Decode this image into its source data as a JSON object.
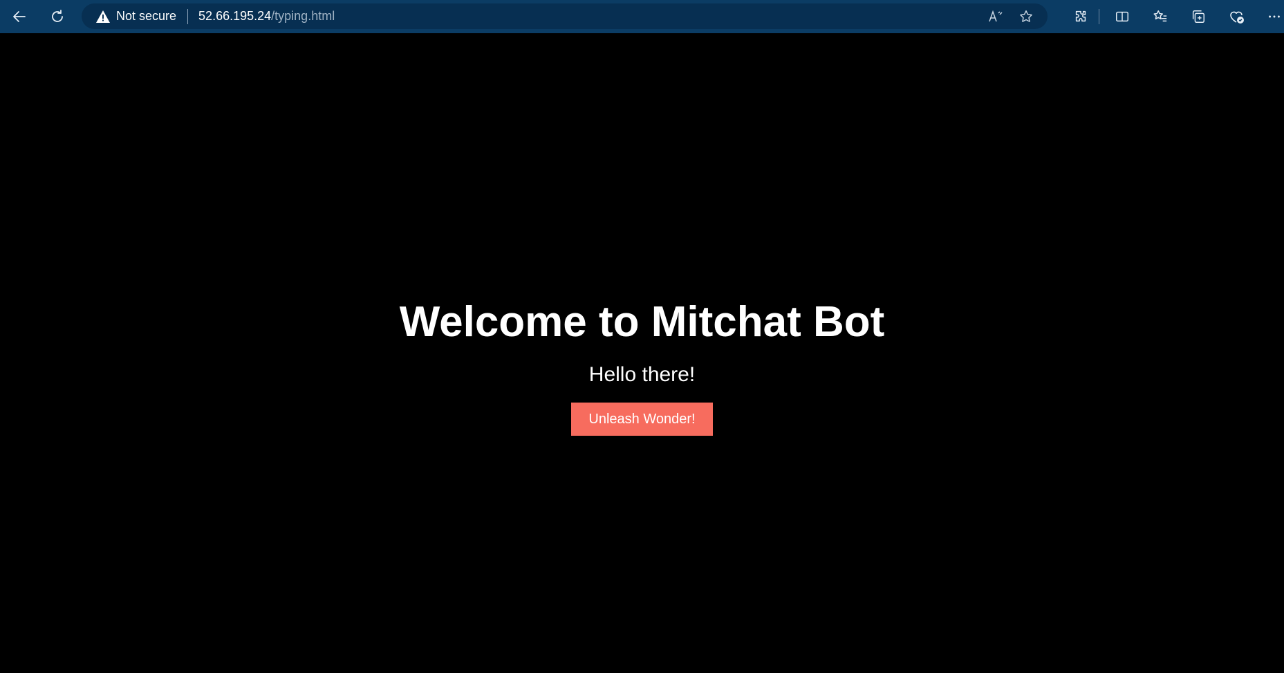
{
  "browser": {
    "security_label": "Not secure",
    "url_host": "52.66.195.24",
    "url_path": "/typing.html",
    "icons": {
      "back": "back-arrow-icon",
      "reload": "reload-icon",
      "warning": "warning-triangle-icon",
      "read_aloud": "read-aloud-icon",
      "favorite": "star-icon",
      "extensions": "puzzle-icon",
      "split_screen": "split-screen-icon",
      "favorites_list": "favorites-list-icon",
      "collections": "collections-icon",
      "health": "browser-essentials-icon",
      "more": "more-dots-icon"
    }
  },
  "page": {
    "title": "Welcome to Mitchat Bot",
    "subtitle": "Hello there!",
    "cta_label": "Unleash Wonder!",
    "colors": {
      "background": "#000000",
      "text": "#ffffff",
      "cta": "#f76c5e",
      "toolbar": "#0b3c64"
    }
  }
}
